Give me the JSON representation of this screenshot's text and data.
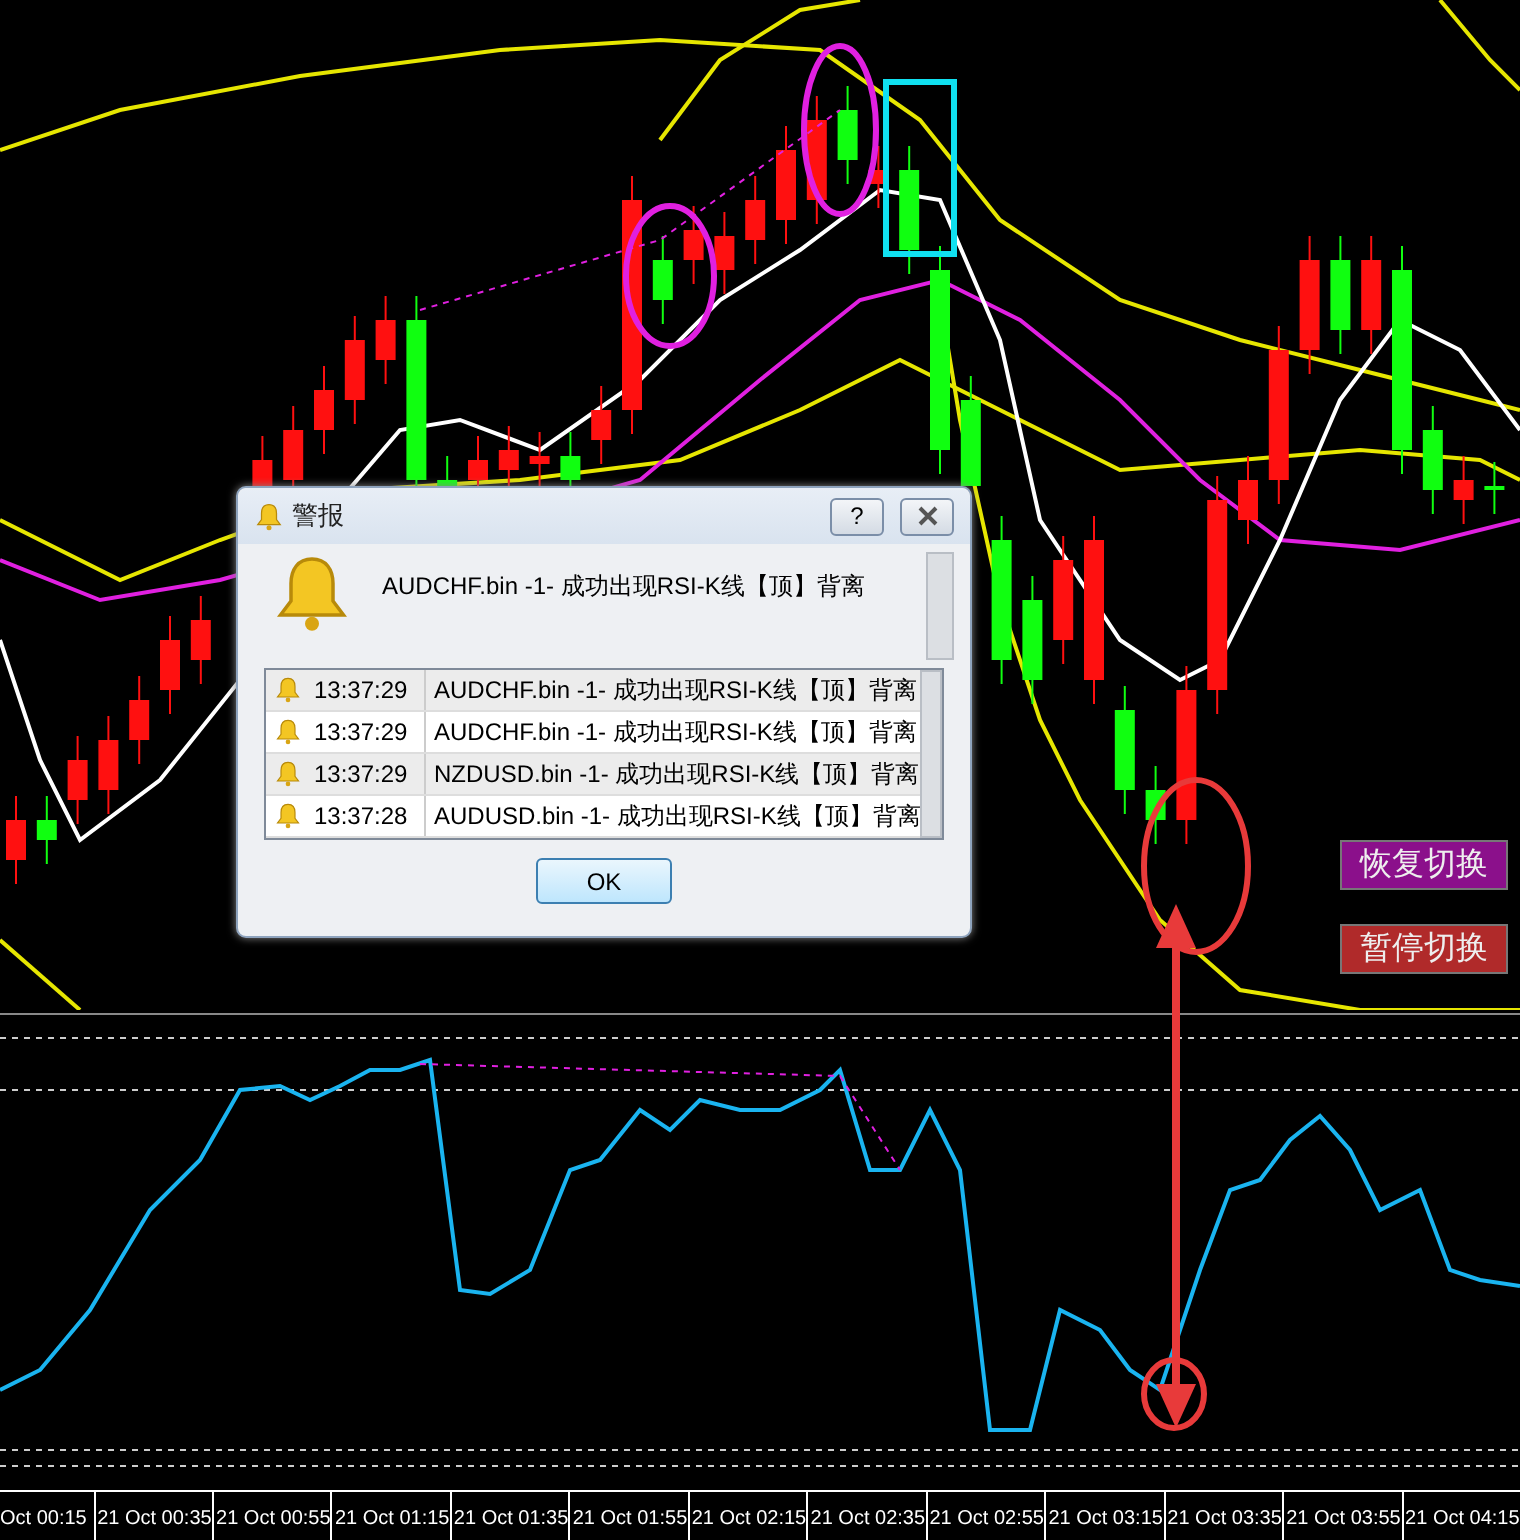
{
  "alert_dialog": {
    "title": "警报",
    "help_button": "?",
    "message": "AUDCHF.bin -1- 成功出现RSI-K线【顶】背离",
    "alerts": [
      {
        "time": "13:37:29",
        "text": "AUDCHF.bin -1- 成功出现RSI-K线【顶】背离"
      },
      {
        "time": "13:37:29",
        "text": "AUDCHF.bin -1- 成功出现RSI-K线【顶】背离"
      },
      {
        "time": "13:37:29",
        "text": "NZDUSD.bin -1- 成功出现RSI-K线【顶】背离"
      },
      {
        "time": "13:37:28",
        "text": "AUDUSD.bin -1- 成功出现RSI-K线【顶】背离"
      }
    ],
    "ok_button": "OK"
  },
  "buttons": [
    {
      "label": "恢复切换",
      "color": "#8b108b"
    },
    {
      "label": "暂停切换",
      "color": "#b02a2a"
    }
  ],
  "time_axis": {
    "labels": [
      "Oct 00:15",
      "21 Oct 00:35",
      "21 Oct 00:55",
      "21 Oct 01:15",
      "21 Oct 01:35",
      "21 Oct 01:55",
      "21 Oct 02:15",
      "21 Oct 02:35",
      "21 Oct 02:55",
      "21 Oct 03:15",
      "21 Oct 03:35",
      "21 Oct 03:55",
      "21 Oct 04:15"
    ]
  }
}
